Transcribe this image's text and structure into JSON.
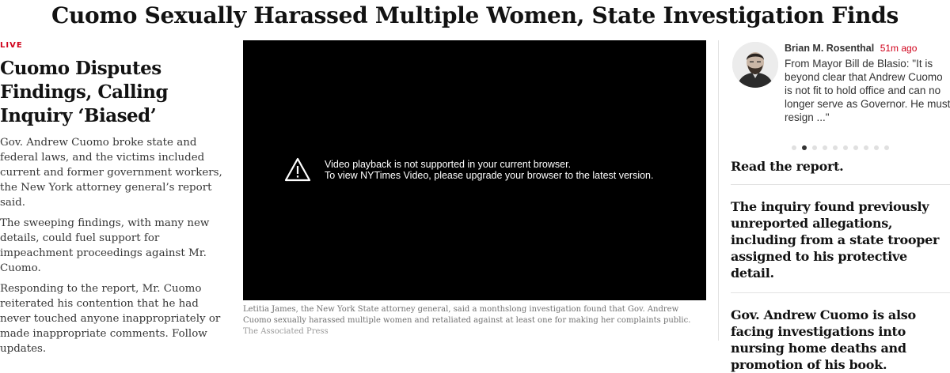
{
  "headline": "Cuomo Sexually Harassed Multiple Women, State Investigation Finds",
  "lead_story": {
    "live_label": "LIVE",
    "title": "Cuomo Disputes Findings, Calling Inquiry ‘Biased’",
    "paragraphs": [
      "Gov. Andrew Cuomo broke state and federal laws, and the victims included current and former government workers, the New York attorney general’s report said.",
      "The sweeping findings, with many new details, could fuel support for impeachment proceedings against Mr. Cuomo.",
      "Responding to the report, Mr. Cuomo reiterated his contention that he had never touched anyone inappropriately or made inappropriate comments."
    ],
    "follow_link": "Follow updates."
  },
  "video": {
    "message_line1": "Video playback is not supported in your current browser.",
    "message_line2": "To view NYTimes Video, please upgrade your browser to the latest version.",
    "caption": "Letitia James, the New York State attorney general, said a monthslong investigation found that Gov. Andrew Cuomo sexually harassed multiple women and retaliated against at least one for making her complaints public.",
    "credit": "The Associated Press"
  },
  "live_update": {
    "author": "Brian M. Rosenthal",
    "time": "51m ago",
    "text": "From Mayor Bill de Blasio: \"It is beyond clear that Andrew Cuomo is not fit to hold office and can no longer serve as Governor. He must resign ...\"",
    "carousel_count": 10,
    "carousel_active": 2
  },
  "side_links": [
    "Read the report.",
    "The inquiry found previously unreported allegations, including from a state trooper assigned to his protective detail.",
    "Gov. Andrew Cuomo is also facing investigations into nursing home deaths and promotion of his book."
  ],
  "colors": {
    "accent_red": "#d0021b",
    "text": "#121212",
    "video_bg": "#000000"
  },
  "icons": {
    "video_warning": "warning-triangle-icon",
    "author": "avatar"
  }
}
